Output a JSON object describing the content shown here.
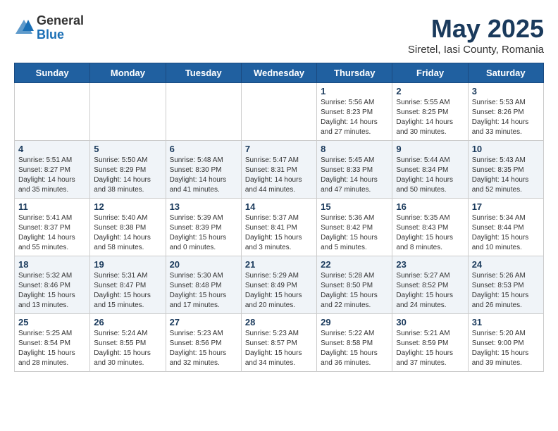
{
  "header": {
    "logo_general": "General",
    "logo_blue": "Blue",
    "month_title": "May 2025",
    "subtitle": "Siretel, Iasi County, Romania"
  },
  "days_of_week": [
    "Sunday",
    "Monday",
    "Tuesday",
    "Wednesday",
    "Thursday",
    "Friday",
    "Saturday"
  ],
  "weeks": [
    [
      {
        "day": "",
        "info": ""
      },
      {
        "day": "",
        "info": ""
      },
      {
        "day": "",
        "info": ""
      },
      {
        "day": "",
        "info": ""
      },
      {
        "day": "1",
        "info": "Sunrise: 5:56 AM\nSunset: 8:23 PM\nDaylight: 14 hours and 27 minutes."
      },
      {
        "day": "2",
        "info": "Sunrise: 5:55 AM\nSunset: 8:25 PM\nDaylight: 14 hours and 30 minutes."
      },
      {
        "day": "3",
        "info": "Sunrise: 5:53 AM\nSunset: 8:26 PM\nDaylight: 14 hours and 33 minutes."
      }
    ],
    [
      {
        "day": "4",
        "info": "Sunrise: 5:51 AM\nSunset: 8:27 PM\nDaylight: 14 hours and 35 minutes."
      },
      {
        "day": "5",
        "info": "Sunrise: 5:50 AM\nSunset: 8:29 PM\nDaylight: 14 hours and 38 minutes."
      },
      {
        "day": "6",
        "info": "Sunrise: 5:48 AM\nSunset: 8:30 PM\nDaylight: 14 hours and 41 minutes."
      },
      {
        "day": "7",
        "info": "Sunrise: 5:47 AM\nSunset: 8:31 PM\nDaylight: 14 hours and 44 minutes."
      },
      {
        "day": "8",
        "info": "Sunrise: 5:45 AM\nSunset: 8:33 PM\nDaylight: 14 hours and 47 minutes."
      },
      {
        "day": "9",
        "info": "Sunrise: 5:44 AM\nSunset: 8:34 PM\nDaylight: 14 hours and 50 minutes."
      },
      {
        "day": "10",
        "info": "Sunrise: 5:43 AM\nSunset: 8:35 PM\nDaylight: 14 hours and 52 minutes."
      }
    ],
    [
      {
        "day": "11",
        "info": "Sunrise: 5:41 AM\nSunset: 8:37 PM\nDaylight: 14 hours and 55 minutes."
      },
      {
        "day": "12",
        "info": "Sunrise: 5:40 AM\nSunset: 8:38 PM\nDaylight: 14 hours and 58 minutes."
      },
      {
        "day": "13",
        "info": "Sunrise: 5:39 AM\nSunset: 8:39 PM\nDaylight: 15 hours and 0 minutes."
      },
      {
        "day": "14",
        "info": "Sunrise: 5:37 AM\nSunset: 8:41 PM\nDaylight: 15 hours and 3 minutes."
      },
      {
        "day": "15",
        "info": "Sunrise: 5:36 AM\nSunset: 8:42 PM\nDaylight: 15 hours and 5 minutes."
      },
      {
        "day": "16",
        "info": "Sunrise: 5:35 AM\nSunset: 8:43 PM\nDaylight: 15 hours and 8 minutes."
      },
      {
        "day": "17",
        "info": "Sunrise: 5:34 AM\nSunset: 8:44 PM\nDaylight: 15 hours and 10 minutes."
      }
    ],
    [
      {
        "day": "18",
        "info": "Sunrise: 5:32 AM\nSunset: 8:46 PM\nDaylight: 15 hours and 13 minutes."
      },
      {
        "day": "19",
        "info": "Sunrise: 5:31 AM\nSunset: 8:47 PM\nDaylight: 15 hours and 15 minutes."
      },
      {
        "day": "20",
        "info": "Sunrise: 5:30 AM\nSunset: 8:48 PM\nDaylight: 15 hours and 17 minutes."
      },
      {
        "day": "21",
        "info": "Sunrise: 5:29 AM\nSunset: 8:49 PM\nDaylight: 15 hours and 20 minutes."
      },
      {
        "day": "22",
        "info": "Sunrise: 5:28 AM\nSunset: 8:50 PM\nDaylight: 15 hours and 22 minutes."
      },
      {
        "day": "23",
        "info": "Sunrise: 5:27 AM\nSunset: 8:52 PM\nDaylight: 15 hours and 24 minutes."
      },
      {
        "day": "24",
        "info": "Sunrise: 5:26 AM\nSunset: 8:53 PM\nDaylight: 15 hours and 26 minutes."
      }
    ],
    [
      {
        "day": "25",
        "info": "Sunrise: 5:25 AM\nSunset: 8:54 PM\nDaylight: 15 hours and 28 minutes."
      },
      {
        "day": "26",
        "info": "Sunrise: 5:24 AM\nSunset: 8:55 PM\nDaylight: 15 hours and 30 minutes."
      },
      {
        "day": "27",
        "info": "Sunrise: 5:23 AM\nSunset: 8:56 PM\nDaylight: 15 hours and 32 minutes."
      },
      {
        "day": "28",
        "info": "Sunrise: 5:23 AM\nSunset: 8:57 PM\nDaylight: 15 hours and 34 minutes."
      },
      {
        "day": "29",
        "info": "Sunrise: 5:22 AM\nSunset: 8:58 PM\nDaylight: 15 hours and 36 minutes."
      },
      {
        "day": "30",
        "info": "Sunrise: 5:21 AM\nSunset: 8:59 PM\nDaylight: 15 hours and 37 minutes."
      },
      {
        "day": "31",
        "info": "Sunrise: 5:20 AM\nSunset: 9:00 PM\nDaylight: 15 hours and 39 minutes."
      }
    ]
  ]
}
